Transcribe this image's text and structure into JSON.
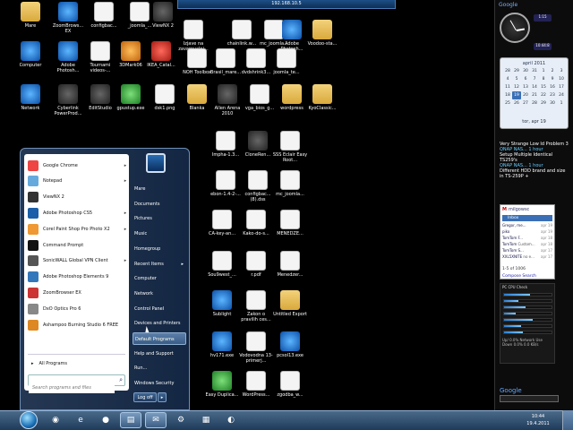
{
  "remote_bar": {
    "title": "192.168.10.5"
  },
  "desktop_icons": [
    {
      "label": "Mare",
      "kind": "folder"
    },
    {
      "label": "ZoomBrows... EX",
      "kind": "app-blue"
    },
    {
      "label": "configbac...",
      "kind": "doc"
    },
    {
      "label": "_joomla_...",
      "kind": "doc"
    },
    {
      "label": "ViewNX 2",
      "kind": "app-dark"
    },
    {
      "label": "Izjave na zavarovalni...",
      "kind": "doc"
    },
    {
      "label": "chainlink.w...",
      "kind": "doc"
    },
    {
      "label": "mc_joomla...",
      "kind": "doc"
    },
    {
      "label": "Adobe Photosh...",
      "kind": "app-blue"
    },
    {
      "label": "Voodoo-sta...",
      "kind": "folder"
    },
    {
      "label": "Computer",
      "kind": "app-blue"
    },
    {
      "label": "Adobe Photosh...",
      "kind": "app-blue"
    },
    {
      "label": "Tournami videos-...",
      "kind": "doc"
    },
    {
      "label": "3DMark06",
      "kind": "app-orange"
    },
    {
      "label": "IKEA_Catal...",
      "kind": "app-red"
    },
    {
      "label": "NOH Toolbox",
      "kind": "doc"
    },
    {
      "label": "Brasil_mare...",
      "kind": "doc"
    },
    {
      "label": "dvdshrink3...",
      "kind": "doc"
    },
    {
      "label": "joomla_te...",
      "kind": "doc"
    },
    {
      "label": "Network",
      "kind": "app-blue"
    },
    {
      "label": "Cyberlink PowerProd...",
      "kind": "app-dark"
    },
    {
      "label": "EditStudio",
      "kind": "app-dark"
    },
    {
      "label": "gpustup.exe",
      "kind": "app-green"
    },
    {
      "label": "dsk1.png",
      "kind": "doc"
    },
    {
      "label": "Blanka",
      "kind": "folder"
    },
    {
      "label": "Allen Arena 2010",
      "kind": "app-dark"
    },
    {
      "label": "vga_bios_g...",
      "kind": "doc"
    },
    {
      "label": "wordpress",
      "kind": "folder"
    },
    {
      "label": "KyoClassic...",
      "kind": "folder"
    },
    {
      "label": "Impha-1.3...",
      "kind": "doc"
    },
    {
      "label": "CloneRen...",
      "kind": "app-dark"
    },
    {
      "label": "SSS Eclair Easy Root...",
      "kind": "doc"
    },
    {
      "label": "ebon-1.4-2-...",
      "kind": "doc"
    },
    {
      "label": "configbac... (8).dss",
      "kind": "doc"
    },
    {
      "label": "mc_joomla...",
      "kind": "doc"
    },
    {
      "label": "CA-key-an...",
      "kind": "doc"
    },
    {
      "label": "Kako-do-s...",
      "kind": "doc"
    },
    {
      "label": "MENEDZE...",
      "kind": "doc"
    },
    {
      "label": "Sou9west_...",
      "kind": "doc"
    },
    {
      "label": "r.pdf",
      "kind": "doc"
    },
    {
      "label": "Menedzer...",
      "kind": "doc"
    },
    {
      "label": "Sublight",
      "kind": "app-blue"
    },
    {
      "label": "Zakon o pravilih ces...",
      "kind": "doc"
    },
    {
      "label": "Untitled Export",
      "kind": "folder"
    },
    {
      "label": "hv171.exe",
      "kind": "app-blue"
    },
    {
      "label": "Vodovodna 13- primerj...",
      "kind": "doc"
    },
    {
      "label": "pcsol13.exe",
      "kind": "app-blue"
    },
    {
      "label": "Easy Duplica...",
      "kind": "app-green"
    },
    {
      "label": "WordPress...",
      "kind": "doc"
    },
    {
      "label": "zgodba_w...",
      "kind": "doc"
    }
  ],
  "start_menu": {
    "programs": [
      {
        "label": "Google Chrome",
        "arrow": "▸",
        "color": "#e44"
      },
      {
        "label": "Notepad",
        "arrow": "▸",
        "color": "#6ad"
      },
      {
        "label": "ViewNX 2",
        "arrow": "",
        "color": "#333"
      },
      {
        "label": "Adobe Photoshop CS5",
        "arrow": "▸",
        "color": "#1a5fa8"
      },
      {
        "label": "Corel Paint Shop Pro Photo X2",
        "arrow": "▸",
        "color": "#e93"
      },
      {
        "label": "Command Prompt",
        "arrow": "",
        "color": "#111"
      },
      {
        "label": "SonicWALL Global VPN Client",
        "arrow": "▸",
        "color": "#555"
      },
      {
        "label": "Adobe Photoshop Elements 9",
        "arrow": "",
        "color": "#37b"
      },
      {
        "label": "ZoomBrowser EX",
        "arrow": "",
        "color": "#c33"
      },
      {
        "label": "DxO Optics Pro 6",
        "arrow": "",
        "color": "#888"
      },
      {
        "label": "Ashampoo Burning Studio 6 FREE",
        "arrow": "",
        "color": "#d82"
      }
    ],
    "all_programs": "All Programs",
    "search_placeholder": "Search programs and files",
    "right_items": [
      {
        "label": "Mare",
        "arrow": ""
      },
      {
        "label": "Documents",
        "arrow": ""
      },
      {
        "label": "Pictures",
        "arrow": ""
      },
      {
        "label": "Music",
        "arrow": ""
      },
      {
        "label": "Homegroup",
        "arrow": ""
      },
      {
        "label": "Recent Items",
        "arrow": "▸"
      },
      {
        "label": "Computer",
        "arrow": ""
      },
      {
        "label": "Network",
        "arrow": ""
      },
      {
        "label": "Control Panel",
        "arrow": ""
      },
      {
        "label": "Devices and Printers",
        "arrow": ""
      },
      {
        "label": "Default Programs",
        "arrow": ""
      },
      {
        "label": "Help and Support",
        "arrow": ""
      },
      {
        "label": "Run...",
        "arrow": ""
      },
      {
        "label": "Windows Security",
        "arrow": ""
      }
    ],
    "shutdown_label": "Log off",
    "shutdown_arrow": "▸",
    "highlighted_item": "Default Programs"
  },
  "sidebar": {
    "header": "Google",
    "gadget_time_1": "1:15",
    "gadget_time_2": "10:44:8",
    "calendar": {
      "title": "april 2011",
      "days": [
        "28",
        "29",
        "30",
        "31",
        "1",
        "2",
        "3",
        "4",
        "5",
        "6",
        "7",
        "8",
        "9",
        "10",
        "11",
        "12",
        "13",
        "14",
        "15",
        "16",
        "17",
        "18",
        "19",
        "20",
        "21",
        "22",
        "23",
        "24",
        "25",
        "26",
        "27",
        "28",
        "29",
        "30",
        "1"
      ],
      "today": "19",
      "footer": "tor, apr 19"
    },
    "rss": [
      {
        "title": "Very Strange Low Id Problem 3",
        "source": "QNAP NAS... 1 hour"
      },
      {
        "title": "Setup Multiple Identical TS259's",
        "source": "QNAP NAS... 1 hour"
      },
      {
        "title": "Different HDD brand and size in TS-259P +",
        "source": ""
      }
    ],
    "gmail": {
      "user": "milgowsc",
      "folder": "Inbox",
      "rows": [
        {
          "from": "Gregor, me...",
          "subject": "",
          "date": "apr 19"
        },
        {
          "from": "piko",
          "subject": "",
          "date": "apr 19"
        },
        {
          "from": "TomTom F...",
          "subject": "",
          "date": "apr 18"
        },
        {
          "from": "TomTom",
          "subject": "Custom...",
          "date": "apr 18"
        },
        {
          "from": "TomTom S...",
          "subject": "",
          "date": "apr 17"
        },
        {
          "from": "XXL5XNITE",
          "subject": "no e...",
          "date": "apr 17"
        }
      ],
      "pager": "1-5 of 1006",
      "links": "Compose  Search"
    },
    "cpu": {
      "title": "PC CPU Check",
      "bars": [
        0.55,
        0.3,
        0.45,
        0.25,
        0.6,
        0.35,
        0.4
      ],
      "stats": [
        "Up/ 0.0%  Network Use",
        "Down 0.0%  0.0 KB/s"
      ]
    },
    "google_search": {
      "logo": "Google",
      "placeholder": ""
    }
  },
  "taskbar": {
    "buttons": [
      "◉",
      "e",
      "●",
      "▤",
      "✉",
      "⚙",
      "▦",
      "◐"
    ],
    "clock_time": "10:44",
    "clock_date": "19.4.2011"
  }
}
